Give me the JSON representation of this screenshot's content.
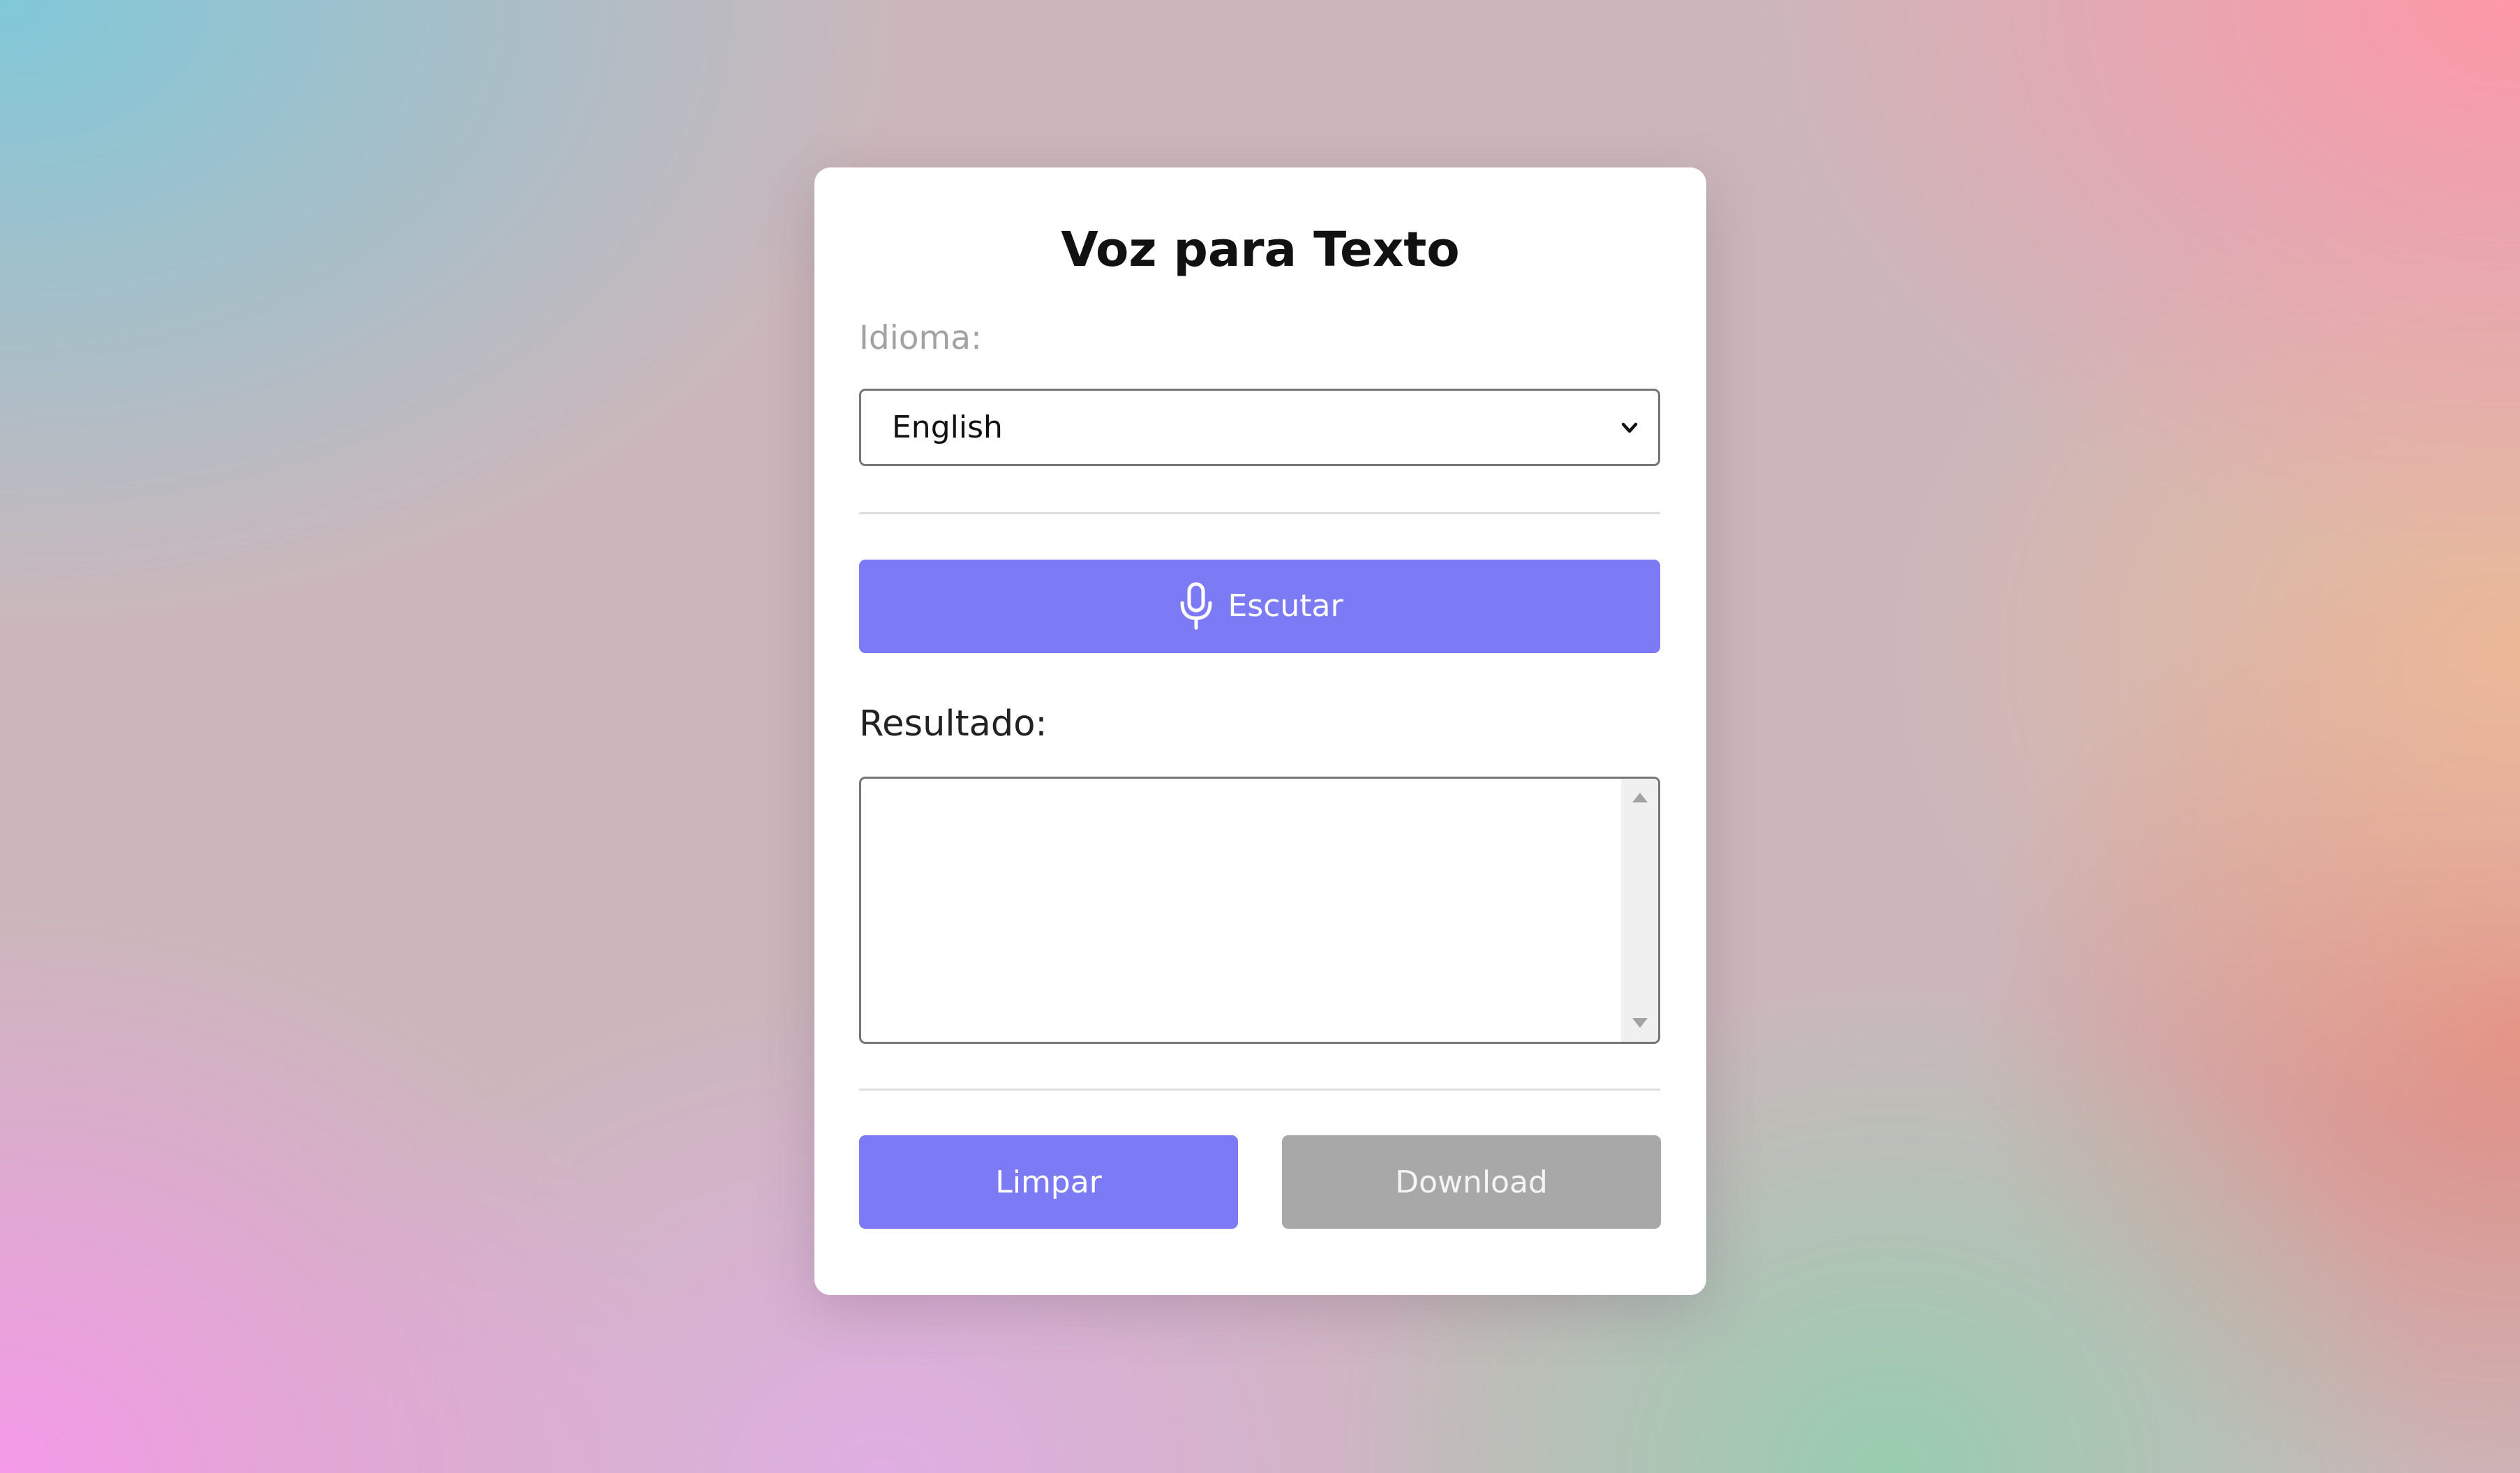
{
  "app": {
    "title": "Voz para Texto"
  },
  "language": {
    "label": "Idioma:",
    "selected": "English"
  },
  "listen_button": {
    "label": "Escutar",
    "icon": "microphone-icon"
  },
  "result": {
    "label": "Resultado:",
    "value": ""
  },
  "actions": {
    "clear_label": "Limpar",
    "download_label": "Download"
  },
  "colors": {
    "accent": "#7c7af5",
    "disabled": "#a8a8a8"
  }
}
